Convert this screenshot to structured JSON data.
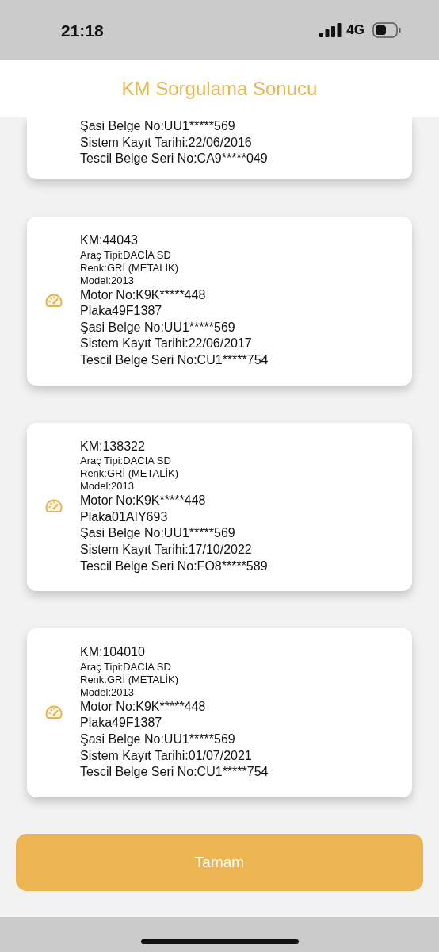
{
  "status_bar": {
    "time": "21:18",
    "network": "4G"
  },
  "header": {
    "title": "KM Sorgulama Sonucu"
  },
  "cards": [
    {
      "clipped": true,
      "lines": [
        {
          "kind": "large",
          "text": "Şasi Belge No:UU1*****569"
        },
        {
          "kind": "large",
          "text": "Sistem Kayıt Tarihi:22/06/2016"
        },
        {
          "kind": "large",
          "text": "Tescil Belge Seri No:CA9*****049"
        }
      ]
    },
    {
      "clipped": false,
      "lines": [
        {
          "kind": "large",
          "text": "KM:44043"
        },
        {
          "kind": "small",
          "text": "Araç Tipi:DACİA SD"
        },
        {
          "kind": "small",
          "text": "Renk:GRİ (METALİK)"
        },
        {
          "kind": "small",
          "text": "Model:2013"
        },
        {
          "kind": "large",
          "text": "Motor No:K9K*****448"
        },
        {
          "kind": "large",
          "text": "Plaka49F1387"
        },
        {
          "kind": "large",
          "text": "Şasi Belge No:UU1*****569"
        },
        {
          "kind": "large",
          "text": "Sistem Kayıt Tarihi:22/06/2017"
        },
        {
          "kind": "large",
          "text": "Tescil Belge Seri No:CU1*****754"
        }
      ]
    },
    {
      "clipped": false,
      "lines": [
        {
          "kind": "large",
          "text": "KM:138322"
        },
        {
          "kind": "small",
          "text": "Araç Tipi:DACIA SD"
        },
        {
          "kind": "small",
          "text": "Renk:GRİ (METALİK)"
        },
        {
          "kind": "small",
          "text": "Model:2013"
        },
        {
          "kind": "large",
          "text": "Motor No:K9K*****448"
        },
        {
          "kind": "large",
          "text": "Plaka01AIY693"
        },
        {
          "kind": "large",
          "text": "Şasi Belge No:UU1*****569"
        },
        {
          "kind": "large",
          "text": "Sistem Kayıt Tarihi:17/10/2022"
        },
        {
          "kind": "large",
          "text": "Tescil Belge Seri No:FO8*****589"
        }
      ]
    },
    {
      "clipped": false,
      "lines": [
        {
          "kind": "large",
          "text": "KM:104010"
        },
        {
          "kind": "small",
          "text": "Araç Tipi:DACİA SD"
        },
        {
          "kind": "small",
          "text": "Renk:GRİ (METALİK)"
        },
        {
          "kind": "small",
          "text": "Model:2013"
        },
        {
          "kind": "large",
          "text": "Motor No:K9K*****448"
        },
        {
          "kind": "large",
          "text": "Plaka49F1387"
        },
        {
          "kind": "large",
          "text": "Şasi Belge No:UU1*****569"
        },
        {
          "kind": "large",
          "text": "Sistem Kayıt Tarihi:01/07/2021"
        },
        {
          "kind": "large",
          "text": "Tescil Belge Seri No:CU1*****754"
        }
      ]
    }
  ],
  "button": {
    "label": "Tamam"
  }
}
